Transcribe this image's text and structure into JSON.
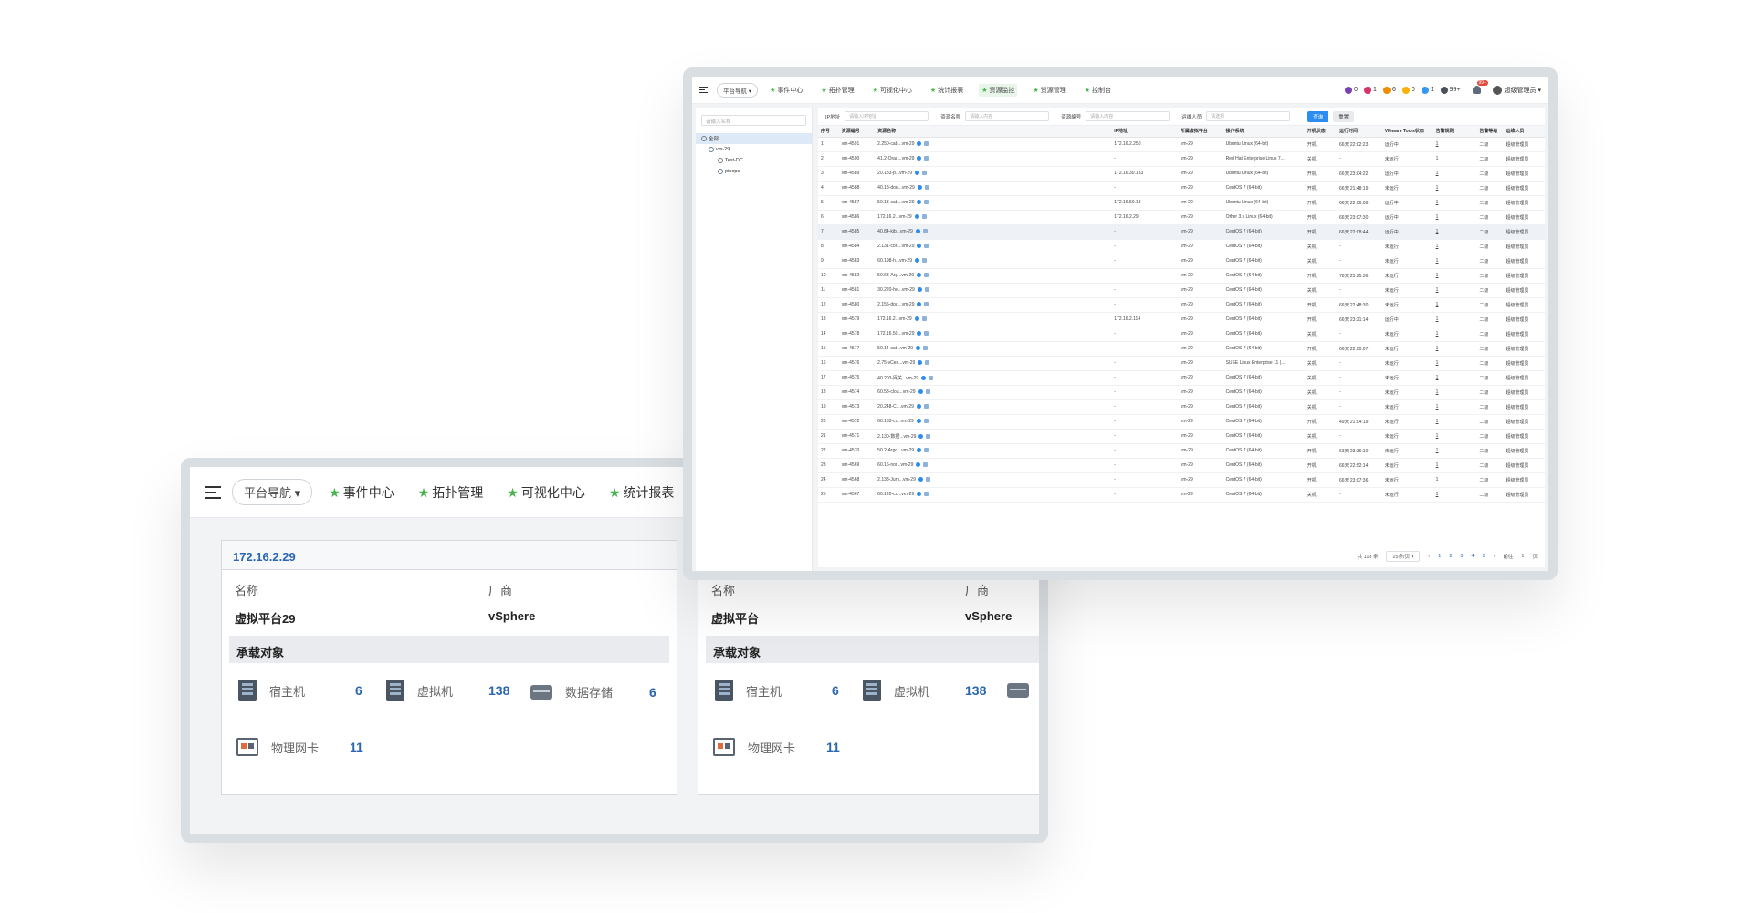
{
  "front": {
    "nav": {
      "platform_nav": "平台导航 ▾",
      "items": [
        "事件中心",
        "拓扑管理",
        "可视化中心",
        "统计报表"
      ]
    },
    "cards": [
      {
        "ip": "172.16.2.29",
        "name_label": "名称",
        "name": "虚拟平台29",
        "vendor_label": "厂商",
        "vendor": "vSphere",
        "section": "承载对象",
        "host_label": "宿主机",
        "host_count": "6",
        "vm_label": "虚拟机",
        "vm_count": "138",
        "storage_label": "数据存储",
        "storage_count": "6",
        "nic_label": "物理网卡",
        "nic_count": "11"
      },
      {
        "name_label": "名称",
        "name": "虚拟平台",
        "vendor_label": "厂商",
        "vendor": "vSphere",
        "section": "承载对象",
        "host_label": "宿主机",
        "host_count": "6",
        "vm_label": "虚拟机",
        "vm_count": "138",
        "nic_label": "物理网卡",
        "nic_count": "11"
      }
    ]
  },
  "back": {
    "nav": {
      "platform_nav": "平台导航 ▾",
      "items": [
        "事件中心",
        "拓扑管理",
        "可视化中心",
        "统计报表",
        "资源监控",
        "资源管理",
        "控制台"
      ],
      "active": "资源监控",
      "alerts": [
        {
          "color": "#7b3fb5",
          "count": "0"
        },
        {
          "color": "#d6336c",
          "count": "1"
        },
        {
          "color": "#f08c00",
          "count": "6"
        },
        {
          "color": "#fab005",
          "count": "0"
        },
        {
          "color": "#339af0",
          "count": "1"
        },
        {
          "color": "#495057",
          "count": "99+"
        }
      ],
      "bell_badge": "99+",
      "user": "超级管理员 ▾"
    },
    "tree": {
      "search_placeholder": "请输入名称",
      "nodes": [
        "全部",
        "vm-29",
        "Test-DC",
        "pinops"
      ]
    },
    "filters": {
      "ip_label": "IP地址",
      "ip_placeholder": "请输入IP地址",
      "name_label": "资源名称",
      "name_placeholder": "请输入内容",
      "code_label": "资源编号",
      "code_placeholder": "请输入内容",
      "owner_label": "运维人员",
      "owner_placeholder": "请选择",
      "query": "查询",
      "reset": "重置"
    },
    "columns": [
      "序号",
      "资源编号",
      "资源名称",
      "IP地址",
      "所属虚拟平台",
      "操作系统",
      "开机状态",
      "运行时间",
      "VMware Tools状态",
      "告警规则",
      "告警等级",
      "运维人员"
    ],
    "rows": [
      [
        "1",
        "vm-4591",
        "2.250-cab...vm-29",
        "172.16.2.250",
        "vm-29",
        "Ubuntu Linux (64-bit)",
        "开机",
        "66天 22:02:23",
        "运行中",
        "1",
        "二级",
        "超级管理员"
      ],
      [
        "2",
        "vm-4590",
        "41.2-Orac...vm-29",
        "-",
        "vm-29",
        "Red Hat Enterprise Linux 7...",
        "关机",
        "-",
        "未运行",
        "1",
        "二级",
        "超级管理员"
      ],
      [
        "3",
        "vm-4589",
        "20.183-p...vm-29",
        "172.16.30.183",
        "vm-29",
        "Ubuntu Linux (64-bit)",
        "开机",
        "66天 23:04:22",
        "运行中",
        "1",
        "二级",
        "超级管理员"
      ],
      [
        "4",
        "vm-4588",
        "40.18-don...vm-29",
        "-",
        "vm-29",
        "CentOS 7 (64-bit)",
        "开机",
        "66天 21:48:19",
        "未运行",
        "1",
        "二级",
        "超级管理员"
      ],
      [
        "5",
        "vm-4587",
        "50.13-cab...vm-29",
        "172.16.50.13",
        "vm-29",
        "Ubuntu Linux (64-bit)",
        "开机",
        "66天 22:06:08",
        "运行中",
        "1",
        "二级",
        "超级管理员"
      ],
      [
        "6",
        "vm-4586",
        "172.16.2...vm-29",
        "172.16.2.29",
        "vm-29",
        "Other 3.x Linux (64-bit)",
        "开机",
        "66天 23:07:30",
        "运行中",
        "1",
        "二级",
        "超级管理员"
      ],
      [
        "7",
        "vm-4585",
        "40.84-kib...vm-29",
        "-",
        "vm-29",
        "CentOS 7 (64-bit)",
        "开机",
        "66天 22:08:44",
        "运行中",
        "1",
        "二级",
        "超级管理员"
      ],
      [
        "8",
        "vm-4584",
        "2.131-con...vm-29",
        "-",
        "vm-29",
        "CentOS 7 (64-bit)",
        "关机",
        "-",
        "未运行",
        "1",
        "二级",
        "超级管理员"
      ],
      [
        "9",
        "vm-4583",
        "60.198-h...vm-29",
        "-",
        "vm-29",
        "CentOS 7 (64-bit)",
        "关机",
        "-",
        "未运行",
        "1",
        "二级",
        "超级管理员"
      ],
      [
        "10",
        "vm-4582",
        "50.63-Arg...vm-29",
        "-",
        "vm-29",
        "CentOS 7 (64-bit)",
        "开机",
        "78天 23:25:36",
        "未运行",
        "1",
        "二级",
        "超级管理员"
      ],
      [
        "11",
        "vm-4581",
        "30.220-ho...vm-29",
        "-",
        "vm-29",
        "CentOS 7 (64-bit)",
        "关机",
        "-",
        "未运行",
        "1",
        "二级",
        "超级管理员"
      ],
      [
        "12",
        "vm-4580",
        "2.155-doc...vm-29",
        "-",
        "vm-29",
        "CentOS 7 (64-bit)",
        "开机",
        "66天 22:48:30",
        "未运行",
        "1",
        "二级",
        "超级管理员"
      ],
      [
        "13",
        "vm-4579",
        "172.16.2...vm-29",
        "172.16.2.114",
        "vm-29",
        "CentOS 7 (64-bit)",
        "开机",
        "66天 23:21:14",
        "运行中",
        "1",
        "二级",
        "超级管理员"
      ],
      [
        "14",
        "vm-4578",
        "172.16.50...vm-29",
        "-",
        "vm-29",
        "CentOS 7 (64-bit)",
        "关机",
        "-",
        "未运行",
        "1",
        "二级",
        "超级管理员"
      ],
      [
        "15",
        "vm-4577",
        "50.14-cat...vm-29",
        "-",
        "vm-29",
        "CentOS 7 (64-bit)",
        "开机",
        "66天 22:00:07",
        "未运行",
        "1",
        "二级",
        "超级管理员"
      ],
      [
        "16",
        "vm-4576",
        "2.75-vCen...vm-29",
        "-",
        "vm-29",
        "SUSE Linux Enterprise 11 (...",
        "关机",
        "-",
        "未运行",
        "1",
        "二级",
        "超级管理员"
      ],
      [
        "17",
        "vm-4575",
        "40.203-网关...vm-29",
        "-",
        "vm-29",
        "CentOS 7 (64-bit)",
        "关机",
        "-",
        "未运行",
        "1",
        "二级",
        "超级管理员"
      ],
      [
        "18",
        "vm-4574",
        "60.58-clou...vm-29",
        "-",
        "vm-29",
        "CentOS 7 (64-bit)",
        "关机",
        "-",
        "未运行",
        "1",
        "二级",
        "超级管理员"
      ],
      [
        "19",
        "vm-4573",
        "20.248-Cl...vm-29",
        "-",
        "vm-29",
        "CentOS 7 (64-bit)",
        "关机",
        "-",
        "未运行",
        "1",
        "二级",
        "超级管理员"
      ],
      [
        "20",
        "vm-4572",
        "60.133-cv...vm-29",
        "-",
        "vm-29",
        "CentOS 7 (64-bit)",
        "开机",
        "49天 21:04:19",
        "未运行",
        "1",
        "二级",
        "超级管理员"
      ],
      [
        "21",
        "vm-4571",
        "2.130-数据...vm-29",
        "-",
        "vm-29",
        "CentOS 7 (64-bit)",
        "关机",
        "-",
        "未运行",
        "1",
        "二级",
        "超级管理员"
      ],
      [
        "22",
        "vm-4570",
        "50.2-Argo...vm-29",
        "-",
        "vm-29",
        "CentOS 7 (64-bit)",
        "开机",
        "63天 23:36:10",
        "未运行",
        "1",
        "二级",
        "超级管理员"
      ],
      [
        "23",
        "vm-4569",
        "60.16-nor...vm-29",
        "-",
        "vm-29",
        "CentOS 7 (64-bit)",
        "开机",
        "66天 22:52:14",
        "未运行",
        "1",
        "二级",
        "超级管理员"
      ],
      [
        "24",
        "vm-4568",
        "2.138-Jum...vm-29",
        "-",
        "vm-29",
        "CentOS 7 (64-bit)",
        "开机",
        "66天 23:07:36",
        "未运行",
        "1",
        "二级",
        "超级管理员"
      ],
      [
        "25",
        "vm-4567",
        "60.120-cs...vm-29",
        "-",
        "vm-29",
        "CentOS 7 (64-bit)",
        "关机",
        "-",
        "未运行",
        "1",
        "二级",
        "超级管理员"
      ]
    ],
    "highlight_row": 7,
    "pager": {
      "total": "共 118 条",
      "page_size": "25条/页 ▾",
      "prev": "‹",
      "pages": [
        "1",
        "2",
        "3",
        "4",
        "5"
      ],
      "next": "›",
      "goto_label": "前往",
      "goto_value": "1",
      "goto_suffix": "页"
    }
  }
}
